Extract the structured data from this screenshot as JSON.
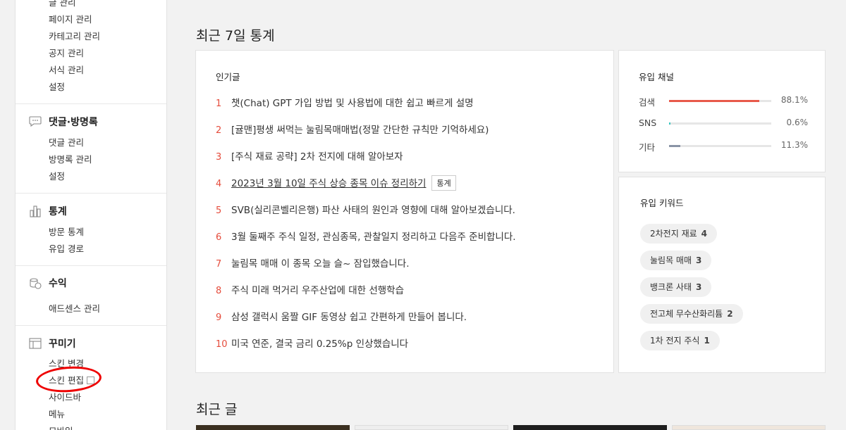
{
  "sidebar": {
    "top_items": [
      "글 관리",
      "페이지 관리",
      "카테고리 관리",
      "공지 관리",
      "서식 관리",
      "설정"
    ],
    "sections": [
      {
        "title": "댓글·방명록",
        "icon": "comment-icon",
        "items": [
          "댓글 관리",
          "방명록 관리",
          "설정"
        ]
      },
      {
        "title": "통계",
        "icon": "bar-chart-icon",
        "items": [
          "방문 통계",
          "유입 경로"
        ]
      },
      {
        "title": "수익",
        "icon": "coins-icon",
        "items": [
          "애드센스 관리"
        ]
      },
      {
        "title": "꾸미기",
        "icon": "layout-icon",
        "items": [
          "스킨 변경",
          "스킨 편집",
          "사이드바",
          "메뉴",
          "모바일"
        ]
      }
    ]
  },
  "main": {
    "stats_title": "최근 7일 통계",
    "recent_title": "최근 글"
  },
  "popular": {
    "title": "인기글",
    "items": [
      {
        "num": "1",
        "title": "챗(Chat) GPT 가입 방법 및 사용법에 대한 쉽고 빠르게 설명"
      },
      {
        "num": "2",
        "title": "[귤맨]평생 써먹는 눌림목매매법(정말 간단한 규칙만 기억하세요)"
      },
      {
        "num": "3",
        "title": "[주식 재료 공략] 2차 전지에 대해 알아보자"
      },
      {
        "num": "4",
        "title": "2023년 3월 10일 주식 상승 종목 이슈 정리하기",
        "tag": "통계"
      },
      {
        "num": "5",
        "title": "SVB(실리콘벨리은행) 파산 사태의 원인과 영향에 대해 알아보겠습니다."
      },
      {
        "num": "6",
        "title": "3월 둘째주 주식 일정, 관심종목, 관찰일지 정리하고 다음주 준비합니다."
      },
      {
        "num": "7",
        "title": "눌림목 매매 이 종목 오늘 슬~ 잠입했습니다."
      },
      {
        "num": "8",
        "title": "주식 미래 먹거리 우주산업에 대한 선행학습"
      },
      {
        "num": "9",
        "title": "삼성 갤럭시 움짤 GIF 동영상 쉽고 간편하게 만들어 봅니다."
      },
      {
        "num": "10",
        "title": "미국 연준, 결국 금리 0.25%p 인상했습니다"
      }
    ]
  },
  "channels": {
    "title": "유입 채널",
    "items": [
      {
        "label": "검색",
        "percent": "88.1%",
        "value": 88.1,
        "color": "#e8594a"
      },
      {
        "label": "SNS",
        "percent": "0.6%",
        "value": 0.6,
        "color": "#3cc7c0"
      },
      {
        "label": "기타",
        "percent": "11.3%",
        "value": 11.3,
        "color": "#8a94a6"
      }
    ]
  },
  "keywords": {
    "title": "유입 키워드",
    "items": [
      {
        "label": "2차전지 재료",
        "count": "4"
      },
      {
        "label": "눌림목 매매",
        "count": "3"
      },
      {
        "label": "뱅크론 사태",
        "count": "3"
      },
      {
        "label": "전고체 무수산화리튬",
        "count": "2"
      },
      {
        "label": "1차 전지 주식",
        "count": "1"
      }
    ]
  }
}
